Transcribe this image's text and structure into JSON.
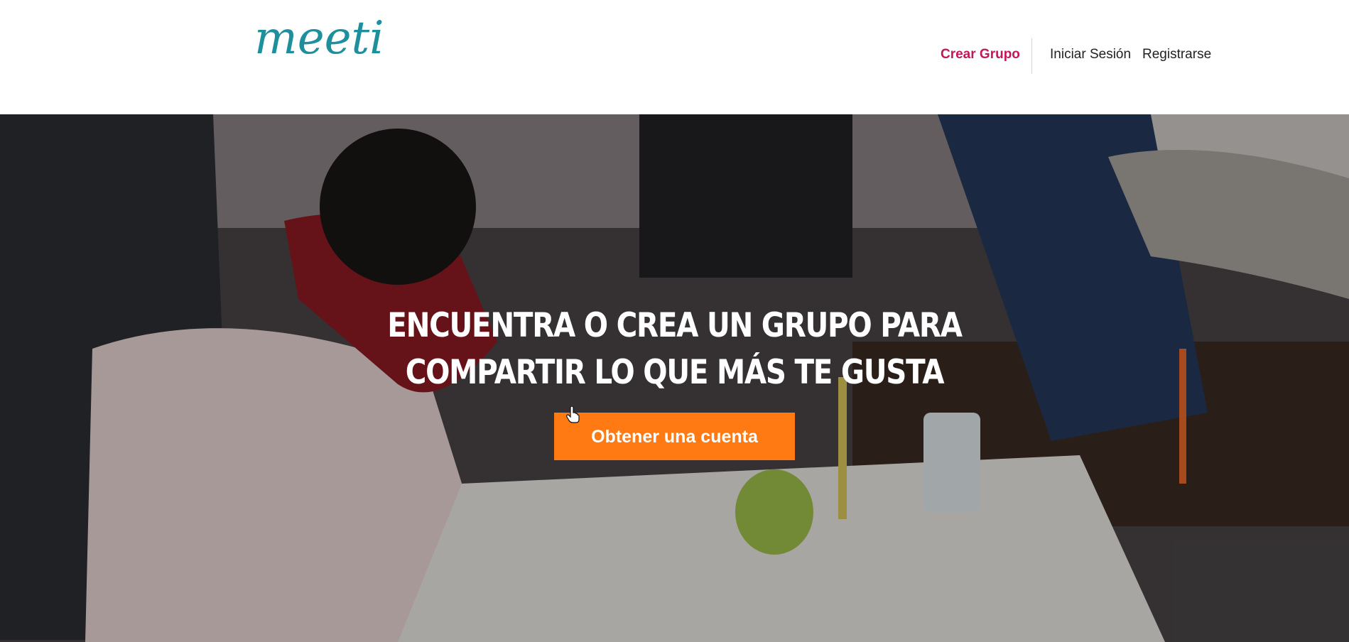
{
  "header": {
    "logo_text": "meeti",
    "nav": {
      "create_group": "Crear Grupo",
      "login": "Iniciar Sesión",
      "register": "Registrarse"
    }
  },
  "hero": {
    "title_line1": "Encuentra o crea un grupo para",
    "title_line2": "compartir lo que más te gusta",
    "cta_label": "Obtener una cuenta",
    "background_image": "people-collaborating-photo"
  },
  "colors": {
    "brand_teal": "#1e8f9c",
    "accent_pink": "#c2185b",
    "cta_orange": "#ff7a12"
  }
}
